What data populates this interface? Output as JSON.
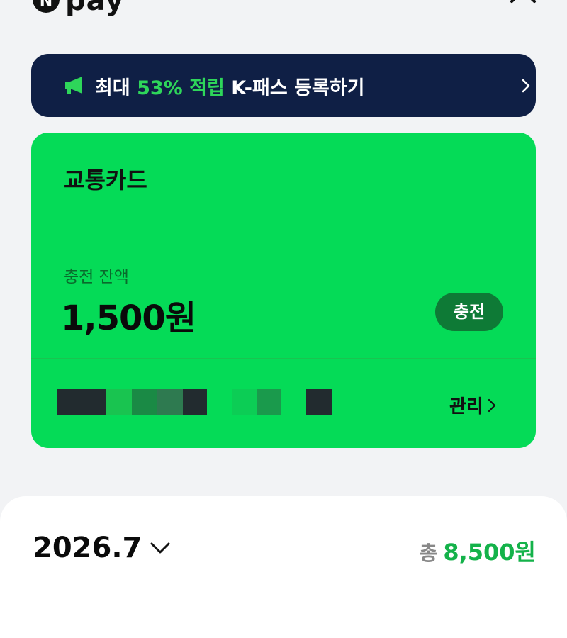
{
  "header": {
    "logo_badge": "N",
    "logo_text": "pay",
    "close_icon": "close-icon"
  },
  "promo": {
    "prefix": "최대 ",
    "highlight": "53% 적립",
    "suffix": " K-패스 등록하기",
    "icon": "megaphone-icon"
  },
  "card": {
    "title": "교통카드",
    "balance_label": "충전 잔액",
    "balance_amount": "1,500원",
    "charge_label": "충전",
    "manage_label": "관리",
    "card_number_masked": true
  },
  "summary": {
    "month": "2026.7",
    "total_label": "총",
    "total_amount": "8,500원"
  },
  "colors": {
    "promo_bg": "#0f1f45",
    "accent_green": "#05db57",
    "charge_btn": "#0e7a36",
    "total_green": "#14b24a"
  }
}
